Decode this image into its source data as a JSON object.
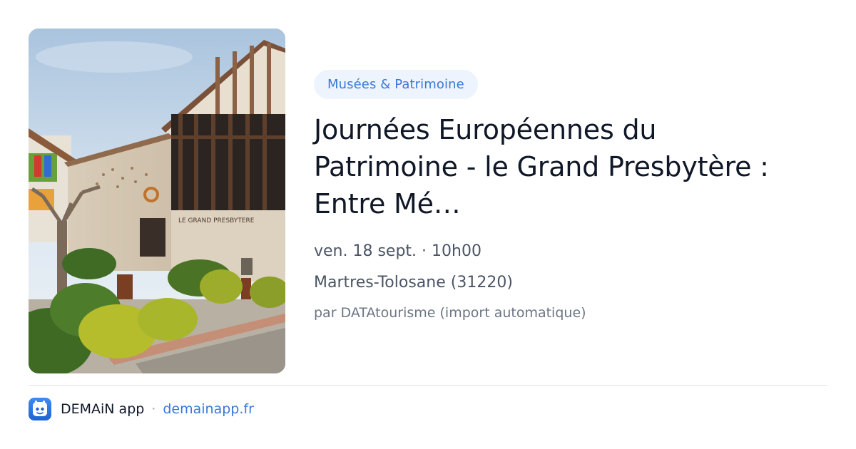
{
  "event": {
    "category": "Musées & Patrimoine",
    "title": "Journées Européennes du Patrimoine - le Grand Presbytère : Entre Mé…",
    "datetime": "ven. 18 sept. · 10h00",
    "location": "Martres-Tolosane (31220)",
    "source": "par DATAtourisme (import automatique)",
    "image": {
      "sign_text": "LE GRAND PRESBYTERE"
    }
  },
  "footer": {
    "app_name": "DEMAiN app",
    "separator": "·",
    "domain": "demainapp.fr",
    "icon": "demain-app-icon"
  },
  "colors": {
    "accent": "#3a78d6",
    "tag_background": "#eef4fd",
    "title": "#101828",
    "meta": "#4b5565"
  }
}
